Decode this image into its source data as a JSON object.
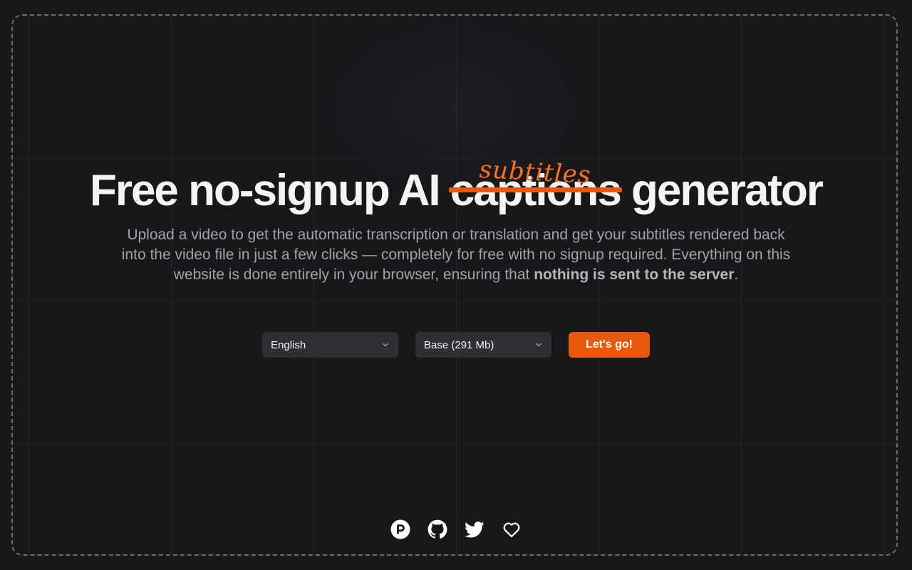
{
  "hero": {
    "title_before": "Free no-signup AI ",
    "title_struck": "captions",
    "title_after": " generator",
    "title_replacement": "subtitles",
    "description_main": "Upload a video to get the automatic transcription or translation and get your subtitles rendered back into the video file in just a few clicks — completely for free with no signup required. Everything on this website is done entirely in your browser, ensuring that ",
    "description_bold": "nothing is sent to the server",
    "description_end": "."
  },
  "controls": {
    "language_selected": "English",
    "model_selected": "Base (291 Mb)",
    "submit_label": "Let's go!"
  },
  "footer": {
    "links": [
      "patreon-icon",
      "github-icon",
      "twitter-icon",
      "heart-icon"
    ]
  },
  "colors": {
    "accent": "#ea580c",
    "background": "#18181b",
    "select_bg": "#2e2e33"
  }
}
